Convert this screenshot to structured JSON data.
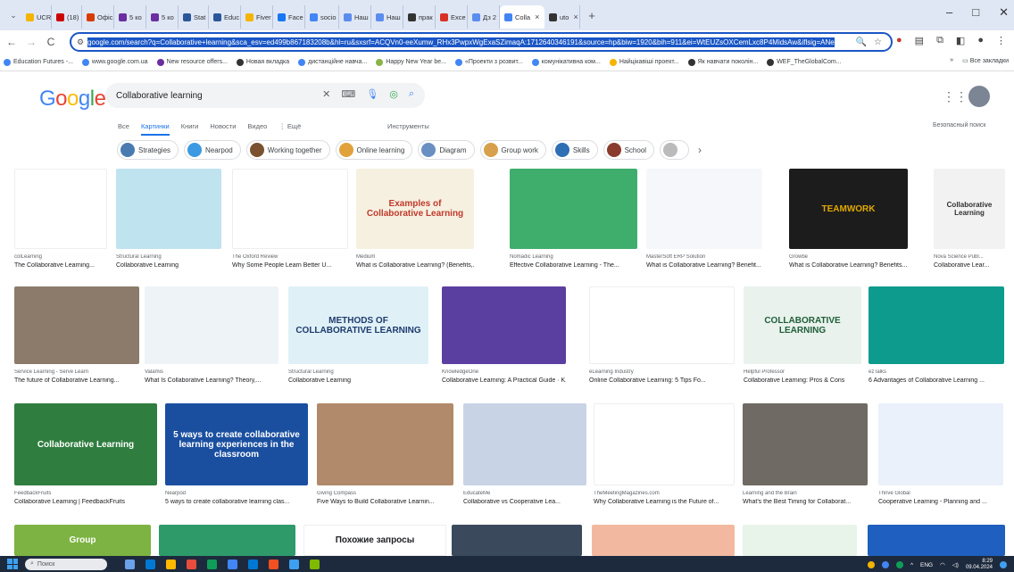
{
  "browser": {
    "tabs": [
      {
        "label": "UCR",
        "color": "#f4b400"
      },
      {
        "label": "(18)",
        "color": "#cc0000"
      },
      {
        "label": "Офіс",
        "color": "#d83b01"
      },
      {
        "label": "5 ко",
        "color": "#6b2fa0"
      },
      {
        "label": "5 ко",
        "color": "#6b2fa0"
      },
      {
        "label": "Stat",
        "color": "#2b579a"
      },
      {
        "label": "Educ",
        "color": "#2b579a"
      },
      {
        "label": "Fiver",
        "color": "#f4b400"
      },
      {
        "label": "Face",
        "color": "#1877f2"
      },
      {
        "label": "socio",
        "color": "#4285f4"
      },
      {
        "label": "Наш",
        "color": "#5b8def"
      },
      {
        "label": "Наш",
        "color": "#5b8def"
      },
      {
        "label": "прак",
        "color": "#333333"
      },
      {
        "label": "Exce",
        "color": "#d93025"
      },
      {
        "label": "Дз 2",
        "color": "#5b8def"
      },
      {
        "label": "Colla",
        "color": "#4285f4"
      },
      {
        "label": "uto",
        "color": "#333333"
      }
    ],
    "url": "google.com/search?q=Collaborative+learning&sca_esv=ed499b867183208b&hl=ru&sxsrf=ACQVn0-eeXumw_RHx3PwpxWgExaSZimaqA:1712640346191&source=hp&biw=1920&bih=911&ei=WtEUZsOXCemLxc8P4MidsAw&iflsig=ANe",
    "bookmarks": [
      {
        "label": "Education Futures -...",
        "color": "#4285f4"
      },
      {
        "label": "www.google.com.ua",
        "color": "#4285f4"
      },
      {
        "label": "New resource offers...",
        "color": "#6b2fa0"
      },
      {
        "label": "Новая вкладка",
        "color": "#333333"
      },
      {
        "label": "дистанційне навча...",
        "color": "#4285f4"
      },
      {
        "label": "Happy New Year be...",
        "color": "#8ab34a"
      },
      {
        "label": "«Проекти з розвит...",
        "color": "#4285f4"
      },
      {
        "label": "комунікативна ком...",
        "color": "#4285f4"
      },
      {
        "label": "Найцікавіші проект...",
        "color": "#f4b400"
      },
      {
        "label": "Як навчати поколін...",
        "color": "#333333"
      },
      {
        "label": "WEF_TheGlobalCom...",
        "color": "#333333"
      }
    ],
    "all_bookmarks": "Все закладки"
  },
  "search": {
    "logo": "Google",
    "query": "Collaborative learning",
    "nav_tabs": [
      "Все",
      "Картинки",
      "Книги",
      "Новости",
      "Видео",
      "⋮ Ещё"
    ],
    "active_tab": 1,
    "tools": "Инструменты",
    "safe_search": "Безопасный поиск",
    "chips": [
      {
        "label": "Strategies",
        "color": "#4a7bb0"
      },
      {
        "label": "Nearpod",
        "color": "#3b9ae1"
      },
      {
        "label": "Working together",
        "color": "#7a5230"
      },
      {
        "label": "Online learning",
        "color": "#e1a23b"
      },
      {
        "label": "Diagram",
        "color": "#6a8fc2"
      },
      {
        "label": "Group work",
        "color": "#d6a14a"
      },
      {
        "label": "Skills",
        "color": "#2e6fb5"
      },
      {
        "label": "School",
        "color": "#8a3b2e"
      },
      {
        "label": "",
        "color": "#bbbbbb"
      }
    ]
  },
  "results": [
    {
      "source": "colLearning",
      "title": "The Collaborative Learning...",
      "bg": "#ffffff",
      "color": "#f4b400",
      "caption": ""
    },
    {
      "source": "Structural Learning",
      "title": "Collaborative Learning",
      "bg": "#bfe3ef",
      "color": "#2a7fa7",
      "caption": ""
    },
    {
      "source": "The Oxford Review",
      "title": "Why Some People Learn Better U...",
      "bg": "#ffffff",
      "color": "#e74c3c",
      "caption": ""
    },
    {
      "source": "Medium",
      "title": "What is Collaborative Learning? (Benefits,...",
      "bg": "#f6f0e0",
      "color": "#c0392b",
      "caption": "Examples of Collaborative Learning"
    },
    {
      "source": "Nomadic Learning",
      "title": "Effective Collaborative Learning - The...",
      "bg": "#3fae6d",
      "color": "#ffffff",
      "caption": ""
    },
    {
      "source": "MasterSoft ERP Solution",
      "title": "What is Collaborative Learning? Benefit...",
      "bg": "#f5f7fb",
      "color": "#7f8fa6",
      "caption": ""
    },
    {
      "source": "Growbe",
      "title": "What is Collaborative Learning? Benefits...",
      "bg": "#1c1c1c",
      "color": "#e0a800",
      "caption": "TEAMWORK"
    },
    {
      "source": "Nova Science Publ...",
      "title": "Collaborative Lear...",
      "bg": "#f2f2f2",
      "color": "#2f2f2f",
      "caption": "Collaborative Learning"
    },
    {
      "source": "Service Learning - Serve Learn",
      "title": "The future of Collaborative Learning...",
      "bg": "#8c7b6b",
      "color": "#ffffff",
      "caption": ""
    },
    {
      "source": "Valamis",
      "title": "What Is Collaborative Learning? Theory,...",
      "bg": "#eef3f8",
      "color": "#2c6fb3",
      "caption": ""
    },
    {
      "source": "Structural Learning",
      "title": "Collaborative Learning",
      "bg": "#dff1f7",
      "color": "#1f3b6e",
      "caption": "METHODS OF COLLABORATIVE LEARNING"
    },
    {
      "source": "KnowledgeOne",
      "title": "Collaborative Learning: A Practical Guide · K...",
      "bg": "#5b3fa0",
      "color": "#ffffff",
      "caption": ""
    },
    {
      "source": "eLearning Industry",
      "title": "Online Collaborative Learning: 5 Tips Fo...",
      "bg": "#ffffff",
      "color": "#f4c430",
      "caption": ""
    },
    {
      "source": "Helpful Professor",
      "title": "Collaborative Learning: Pros & Cons",
      "bg": "#e9f2ec",
      "color": "#1f5e3a",
      "caption": "COLLABORATIVE LEARNING"
    },
    {
      "source": "ezTalks",
      "title": "6 Advantages of Collaborative Learning ...",
      "bg": "#0c9b8c",
      "color": "#ffffff",
      "caption": ""
    },
    {
      "source": "FeedbackFruits",
      "title": "Collaborative Learning | FeedbackFruits",
      "bg": "#2f7d3f",
      "color": "#ffffff",
      "caption": "Collaborative Learning"
    },
    {
      "source": "Nearpod",
      "title": "5 ways to create collaborative learning clas...",
      "bg": "#1a4fa0",
      "color": "#ffffff",
      "caption": "5 ways to create collaborative learning experiences in the classroom"
    },
    {
      "source": "Giving Compass",
      "title": "Five Ways to Build Collaborative Learnin...",
      "bg": "#b08a6a",
      "color": "#ffffff",
      "caption": ""
    },
    {
      "source": "EducateMe",
      "title": "Collaborative vs Cooperative Lea...",
      "bg": "#c9d3e6",
      "color": "#3a4a7a",
      "caption": ""
    },
    {
      "source": "TheMeetingMagazines.com",
      "title": "Why Collaborative Learning is the Future of...",
      "bg": "#ffffff",
      "color": "#e67e22",
      "caption": ""
    },
    {
      "source": "Learning and the Brain",
      "title": "What's the Best Timing for Collaborat...",
      "bg": "#6f6a63",
      "color": "#ffffff",
      "caption": ""
    },
    {
      "source": "Thrive Global",
      "title": "Cooperative Learning - Planning and ...",
      "bg": "#eaf1fb",
      "color": "#2e6fb5",
      "caption": ""
    },
    {
      "source": "",
      "title": "",
      "bg": "#7cb342",
      "color": "#ffffff",
      "caption": "Group"
    },
    {
      "source": "",
      "title": "",
      "bg": "#2e9a6a",
      "color": "#ffffff",
      "caption": ""
    },
    {
      "source": "",
      "title": "",
      "bg": "#ffffff",
      "color": "#202124",
      "caption": "Похожие запросы"
    },
    {
      "source": "",
      "title": "",
      "bg": "#3a4a5c",
      "color": "#ffffff",
      "caption": ""
    },
    {
      "source": "",
      "title": "",
      "bg": "#f2b9a0",
      "color": "#ffffff",
      "caption": ""
    },
    {
      "source": "",
      "title": "",
      "bg": "#e8f3ea",
      "color": "#333333",
      "caption": ""
    },
    {
      "source": "",
      "title": "",
      "bg": "#1f5fbf",
      "color": "#ffffff",
      "caption": ""
    }
  ],
  "taskbar": {
    "search_placeholder": "Поиск",
    "apps": [
      "#6aa1e8",
      "#0078d4",
      "#ffb900",
      "#e74c3c",
      "#0f9d58",
      "#4285f4",
      "#0078d4",
      "#f25022",
      "#3ea0f0",
      "#7fba00"
    ],
    "lang": "ENG",
    "time": "8:29",
    "date": "09.04.2024"
  }
}
